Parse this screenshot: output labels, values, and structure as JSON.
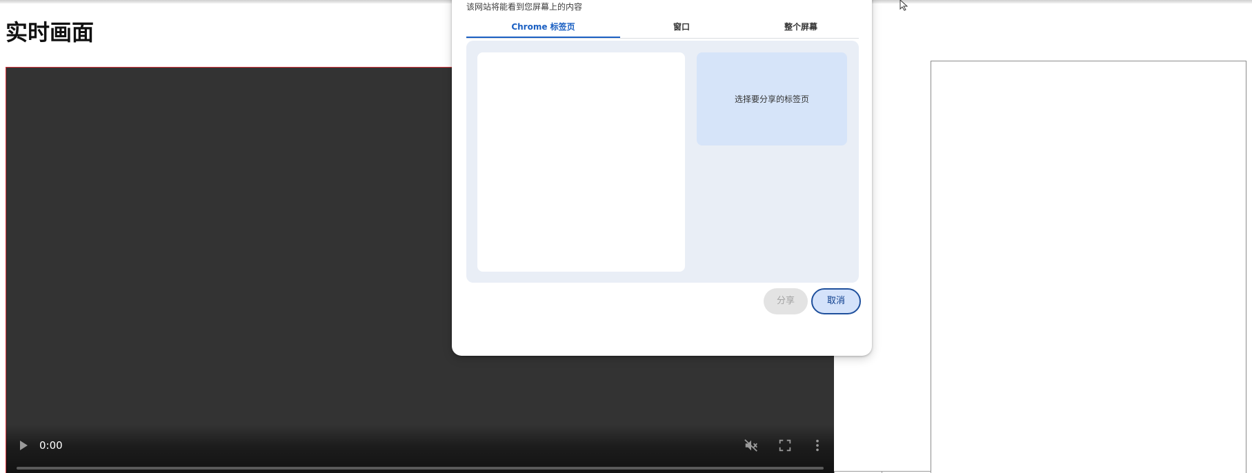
{
  "page": {
    "title": "实时画面"
  },
  "video": {
    "time": "0:00",
    "play_icon": "play-icon",
    "mute_icon": "volume-muted-icon",
    "fullscreen_icon": "fullscreen-icon",
    "menu_icon": "more-vert-icon"
  },
  "dialog": {
    "subtitle": "该网站将能看到您屏幕上的内容",
    "tabs": [
      {
        "label": "Chrome 标签页",
        "active": true
      },
      {
        "label": "窗口",
        "active": false
      },
      {
        "label": "整个屏幕",
        "active": false
      }
    ],
    "preview_hint": "选择要分享的标签页",
    "share_label": "分享",
    "cancel_label": "取消"
  },
  "colors": {
    "accent": "#1a5fc2",
    "video_bg": "#333333",
    "content_bg": "#e9eef6",
    "preview_bg": "#d6e4f9"
  }
}
